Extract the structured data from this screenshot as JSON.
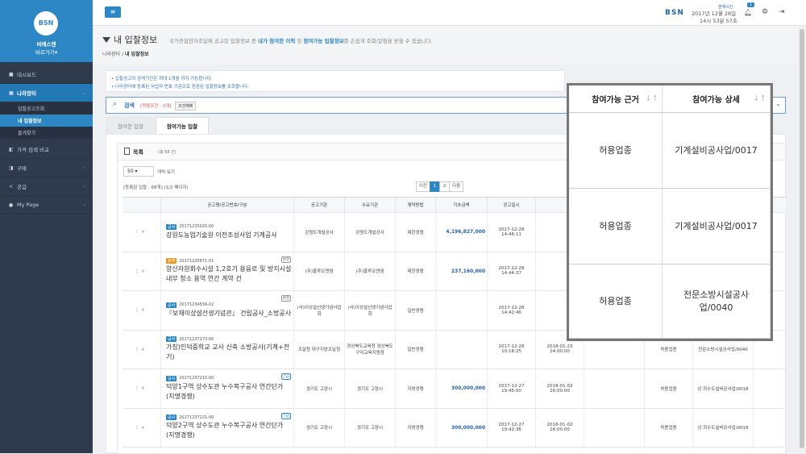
{
  "brand": {
    "logo": "BSN",
    "name": "비에스엔",
    "go": "바로가기▾"
  },
  "sidebar": {
    "items": [
      {
        "label": "대시보드",
        "icon": "dashboard-icon"
      },
      {
        "label": "나라장터",
        "icon": "building-icon"
      },
      {
        "label": "가격 검색 비교",
        "icon": "search-icon"
      },
      {
        "label": "구매",
        "icon": "cart-icon"
      },
      {
        "label": "공급",
        "icon": "share-icon"
      },
      {
        "label": "My Page",
        "icon": "map-marker-icon"
      }
    ],
    "subitems": [
      "입찰공고조회",
      "내 입찰정보",
      "즐겨찾기"
    ]
  },
  "topbar": {
    "bsn": "BSN",
    "time_label": "현재시간",
    "date": "2017년 12월 28일",
    "clock": "14시 53분 57초",
    "bell_count": "1"
  },
  "page": {
    "title": "내 입찰정보",
    "desc_pre": "국가종합전자조달에 공고된 입찰정보 중 ",
    "desc_b1": "내가 참여한 이력",
    "desc_mid": " 및 ",
    "desc_b2": "참여가능 입찰정보",
    "desc_post": "를 손쉽게 조회/알림을 받을 수 있습니다.",
    "crumb_root": "나라장터",
    "crumb_current": "내 입찰정보"
  },
  "notice": [
    "입찰공고의 검색기간은 최대 1개월 까지 가능합니다.",
    "나라장터에 등록된 사업자 번호 기준으로 연관된 입찰정보를 조회합니다."
  ],
  "search": {
    "label": "검색",
    "condition": "[적용조건 : 2개]",
    "reset": "조건해제"
  },
  "tabs": {
    "done": "참여한 입찰",
    "avail": "참여가능 입찰"
  },
  "list": {
    "title": "목록",
    "count": "(총 68 건)",
    "per_page": "50",
    "per_page_label": "개씩 보기",
    "reg_info": "[등록된 입찰 : 68개] (1/2 페이지)",
    "pager": [
      "이전",
      "1",
      "2",
      "다음"
    ]
  },
  "table": {
    "headers": [
      "",
      "공고명/공고번호/구분",
      "공고기관",
      "수요기관",
      "계약방법",
      "기초금액",
      "공고일시",
      "",
      "",
      "",
      ""
    ],
    "rows": [
      {
        "tag": "공사",
        "tag_color": "blue",
        "no": "20171235025-00",
        "badge": "",
        "title": "강원도농업기술원 이전조성사업 기계공사",
        "org": "강원도개발공사",
        "demand": "강원도개발공사",
        "method": "제한경쟁",
        "amount": "4,196,827,000",
        "date": "2017-12-28\n14:46:11",
        "close": "",
        "allow": "",
        "detail": ""
      },
      {
        "tag": "용역",
        "tag_color": "orange",
        "no": "20171235871-01",
        "badge": "변경",
        "title": "양산자원회수시설 1,2호기 용융로 및 방지시설 내부 청소 용역 연간 계약 건",
        "org": "(주)블루오앤엠",
        "demand": "(주)블루오앤엠",
        "method": "제한경쟁",
        "amount": "237,160,000",
        "date": "2017-12-28\n14:44:37",
        "close": "",
        "allow": "",
        "detail": ""
      },
      {
        "tag": "공사",
        "tag_color": "blue",
        "no": "20171234556-02",
        "badge": "변경",
        "title": "『보재이상설선생기념관』 건립공사_소방공사",
        "org": "(사)이상설선생기념사업회",
        "demand": "(사)이상설선생기념사업회",
        "method": "일반경쟁",
        "amount": "",
        "date": "2017-12-28\n14:42:46",
        "close": "",
        "allow": "",
        "detail": ""
      },
      {
        "tag": "공사",
        "tag_color": "blue",
        "no": "20171237273-00",
        "badge": "",
        "title": "가칭)인덕중학교 교사 신축 소방공사(기계+전기)",
        "org": "조달청 대구지방조달청",
        "demand": "경상북도교육청 경상북도구미교육지원청",
        "method": "일반경쟁",
        "amount": "",
        "date": "2017-12-28\n10:18:25",
        "close": "2018-01-23\n14:00:00",
        "allow": "허용업종",
        "detail": "전문소방시설공사업/0040"
      },
      {
        "tag": "공사",
        "tag_color": "blue",
        "no": "20171237215-00",
        "badge": "긴급",
        "title": "덕양1구역 상수도관 누수복구공사 연간단가 (지명경쟁)",
        "org": "경기도 고양시",
        "demand": "경기도 고양시",
        "method": "지명경쟁",
        "amount": "300,000,000",
        "date": "2017-12-27\n19:45:00",
        "close": "2018-01-02\n16:00:00",
        "allow": "허용업종",
        "detail": "상.하수도설비공사업/0018"
      },
      {
        "tag": "공사",
        "tag_color": "blue",
        "no": "20171237221-00",
        "badge": "긴급",
        "title": "덕양2구역 상수도관 누수복구공사 연간단가 (지명경쟁)",
        "org": "경기도 고양시",
        "demand": "경기도 고양시",
        "method": "지명경쟁",
        "amount": "300,000,000",
        "date": "2017-12-27\n19:42:36",
        "close": "2018-01-02\n16:00:00",
        "allow": "허용업종",
        "detail": "상.하수도설비공사업/0018"
      }
    ]
  },
  "overlay": {
    "headers": [
      "참여가능 근거",
      "참여가능 상세"
    ],
    "rows": [
      [
        "허용업종",
        "기계설비공사업/0017"
      ],
      [
        "허용업종",
        "기계설비공사업/0017"
      ],
      [
        "허용업종",
        "전문소방시설공사업/0040"
      ]
    ]
  },
  "colors": {
    "primary": "#2e87c5",
    "sidebar": "#2f3a4c",
    "amount": "#2463a8"
  }
}
